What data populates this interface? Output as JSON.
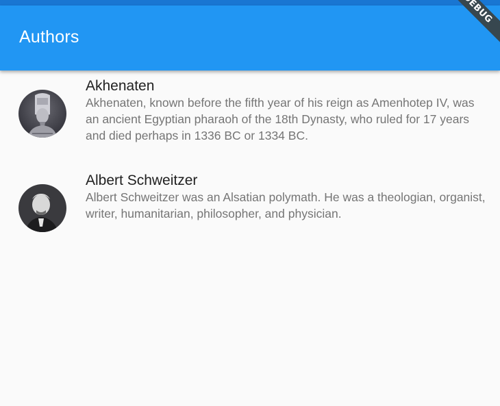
{
  "app_bar": {
    "title": "Authors",
    "color": "#2196f3"
  },
  "debug_banner": {
    "label": "DEBUG"
  },
  "authors": [
    {
      "name": "Akhenaten",
      "description": "Akhenaten, known before the fifth year of his reign as Amenhotep IV, was an ancient Egyptian pharaoh of the 18th Dynasty, who ruled for 17 years and died perhaps in 1336 BC or 1334 BC."
    },
    {
      "name": "Albert Schweitzer",
      "description": "Albert Schweitzer was an Alsatian polymath. He was a theologian, organist, writer, humanitarian, philosopher, and physician."
    }
  ]
}
